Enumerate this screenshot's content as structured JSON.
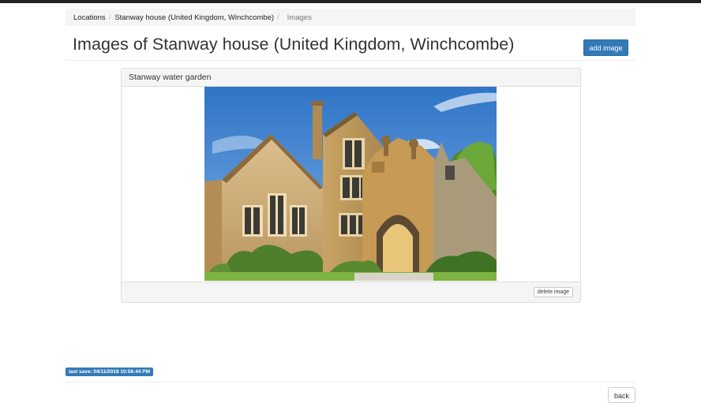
{
  "breadcrumb": {
    "items": [
      {
        "label": "Locations"
      },
      {
        "label": "Stanway house (United Kingdom, Winchcombe)"
      }
    ],
    "separator": "/",
    "active": "Images"
  },
  "header": {
    "title": "Images of Stanway house (United Kingdom, Winchcombe)",
    "add_button_label": "add image"
  },
  "images": [
    {
      "caption": "Stanway water garden",
      "delete_label": "delete image"
    }
  ],
  "status": {
    "last_save": "last save: 04/11/2018 10:56:44 PM"
  },
  "footer": {
    "back_label": "back"
  },
  "colors": {
    "primary": "#337ab7",
    "topbar": "#222222",
    "panel_bg": "#f5f5f5"
  }
}
